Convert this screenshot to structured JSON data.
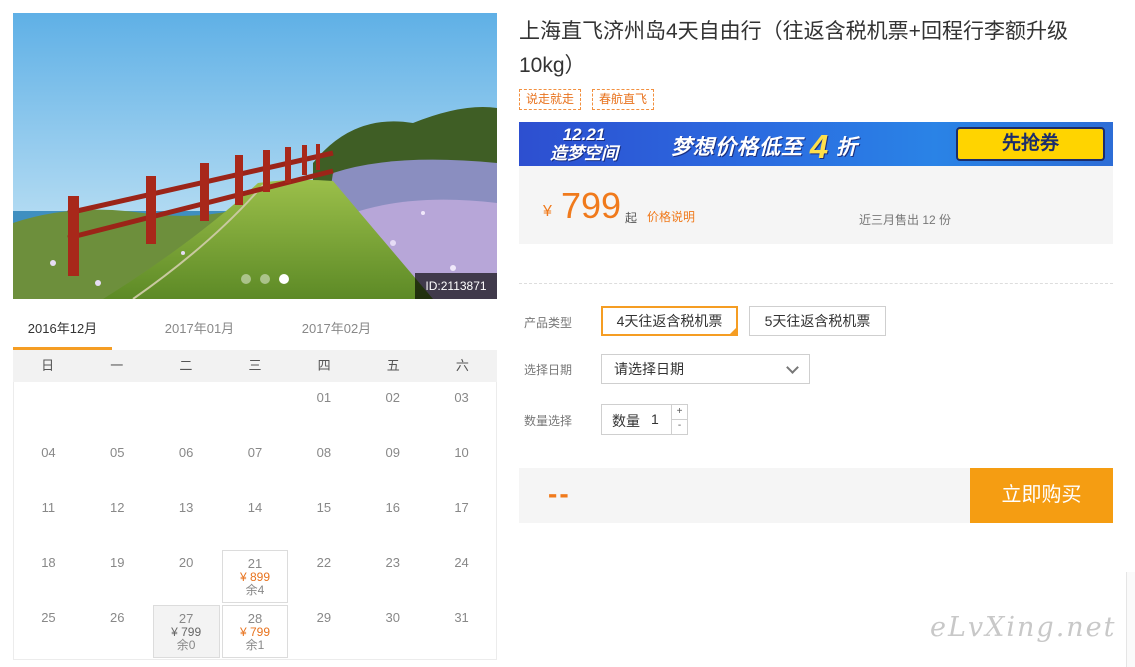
{
  "photo": {
    "id_label": "ID:2113871",
    "slide_count": 3,
    "active_slide": 3
  },
  "calendar": {
    "tabs": [
      {
        "label": "2016年12月",
        "active": true
      },
      {
        "label": "2017年01月",
        "active": false
      },
      {
        "label": "2017年02月",
        "active": false
      }
    ],
    "weekdays": [
      "日",
      "一",
      "二",
      "三",
      "四",
      "五",
      "六"
    ],
    "days": [
      {
        "d": ""
      },
      {
        "d": ""
      },
      {
        "d": ""
      },
      {
        "d": ""
      },
      {
        "d": "01"
      },
      {
        "d": "02"
      },
      {
        "d": "03"
      },
      {
        "d": "04"
      },
      {
        "d": "05"
      },
      {
        "d": "06"
      },
      {
        "d": "07"
      },
      {
        "d": "08"
      },
      {
        "d": "09"
      },
      {
        "d": "10"
      },
      {
        "d": "11"
      },
      {
        "d": "12"
      },
      {
        "d": "13"
      },
      {
        "d": "14"
      },
      {
        "d": "15"
      },
      {
        "d": "16"
      },
      {
        "d": "17"
      },
      {
        "d": "18"
      },
      {
        "d": "19"
      },
      {
        "d": "20"
      },
      {
        "d": "21",
        "price": "¥ 899",
        "stock": "余4",
        "state": "avail"
      },
      {
        "d": "22"
      },
      {
        "d": "23"
      },
      {
        "d": "24"
      },
      {
        "d": "25"
      },
      {
        "d": "26"
      },
      {
        "d": "27",
        "price": "¥ 799",
        "stock": "余0",
        "state": "sold"
      },
      {
        "d": "28",
        "price": "¥ 799",
        "stock": "余1",
        "state": "avail"
      },
      {
        "d": "29"
      },
      {
        "d": "30"
      },
      {
        "d": "31"
      }
    ]
  },
  "product": {
    "title": "上海直飞济州岛4天自由行（往返含税机票+回程行李额升级10kg）",
    "tags": [
      "说走就走",
      "春航直飞"
    ]
  },
  "banner": {
    "logo_line1": "12.21",
    "logo_line2": "造梦空间",
    "text_before": "梦想价格低至",
    "text_big": "4",
    "text_after": "折",
    "button": "先抢券"
  },
  "price": {
    "symbol": "¥",
    "value": "799",
    "unit": "起",
    "note": "价格说明",
    "sold": "近三月售出 12 份"
  },
  "options": {
    "type_label": "产品类型",
    "types": [
      {
        "label": "4天往返含税机票",
        "selected": true
      },
      {
        "label": "5天往返含税机票",
        "selected": false
      }
    ],
    "date_label": "选择日期",
    "date_placeholder": "请选择日期",
    "qty_label": "数量选择",
    "qty_field_label": "数量",
    "qty_value": "1",
    "qty_plus": "+",
    "qty_minus": "-"
  },
  "purchase": {
    "total": "--",
    "buy_button": "立即购买"
  },
  "watermark": "eLvXing.net",
  "colors": {
    "accent": "#f59d12",
    "price": "#f07a1c",
    "banner": "#2b6be0"
  }
}
